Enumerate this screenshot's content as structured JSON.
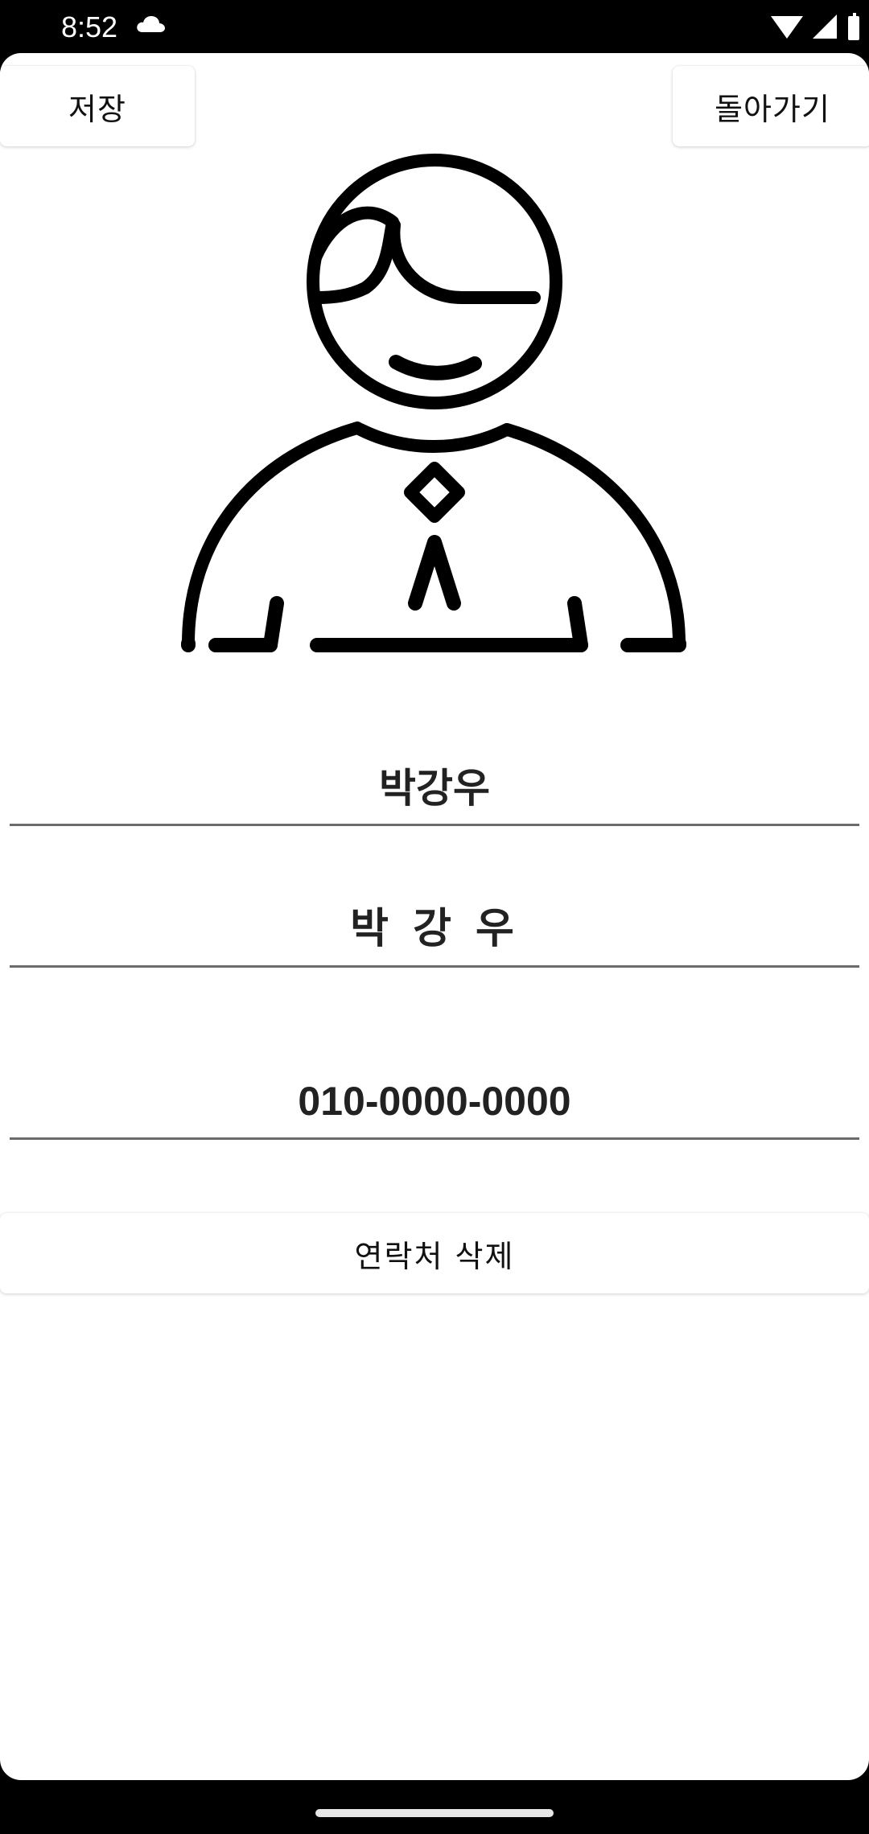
{
  "status_bar": {
    "time": "8:52",
    "icons": [
      "cloud-icon",
      "wifi-icon",
      "signal-icon",
      "battery-icon"
    ]
  },
  "toolbar": {
    "save_label": "저장",
    "back_label": "돌아가기"
  },
  "contact": {
    "avatar_icon": "person-avatar-icon",
    "name": "박강우",
    "name_spaced": "박 강 우",
    "phone": "010-0000-0000"
  },
  "actions": {
    "delete_label": "연락처 삭제"
  },
  "colors": {
    "background": "#ffffff",
    "system_bars": "#000000",
    "text": "#222222",
    "underline": "#6b6b6b"
  }
}
